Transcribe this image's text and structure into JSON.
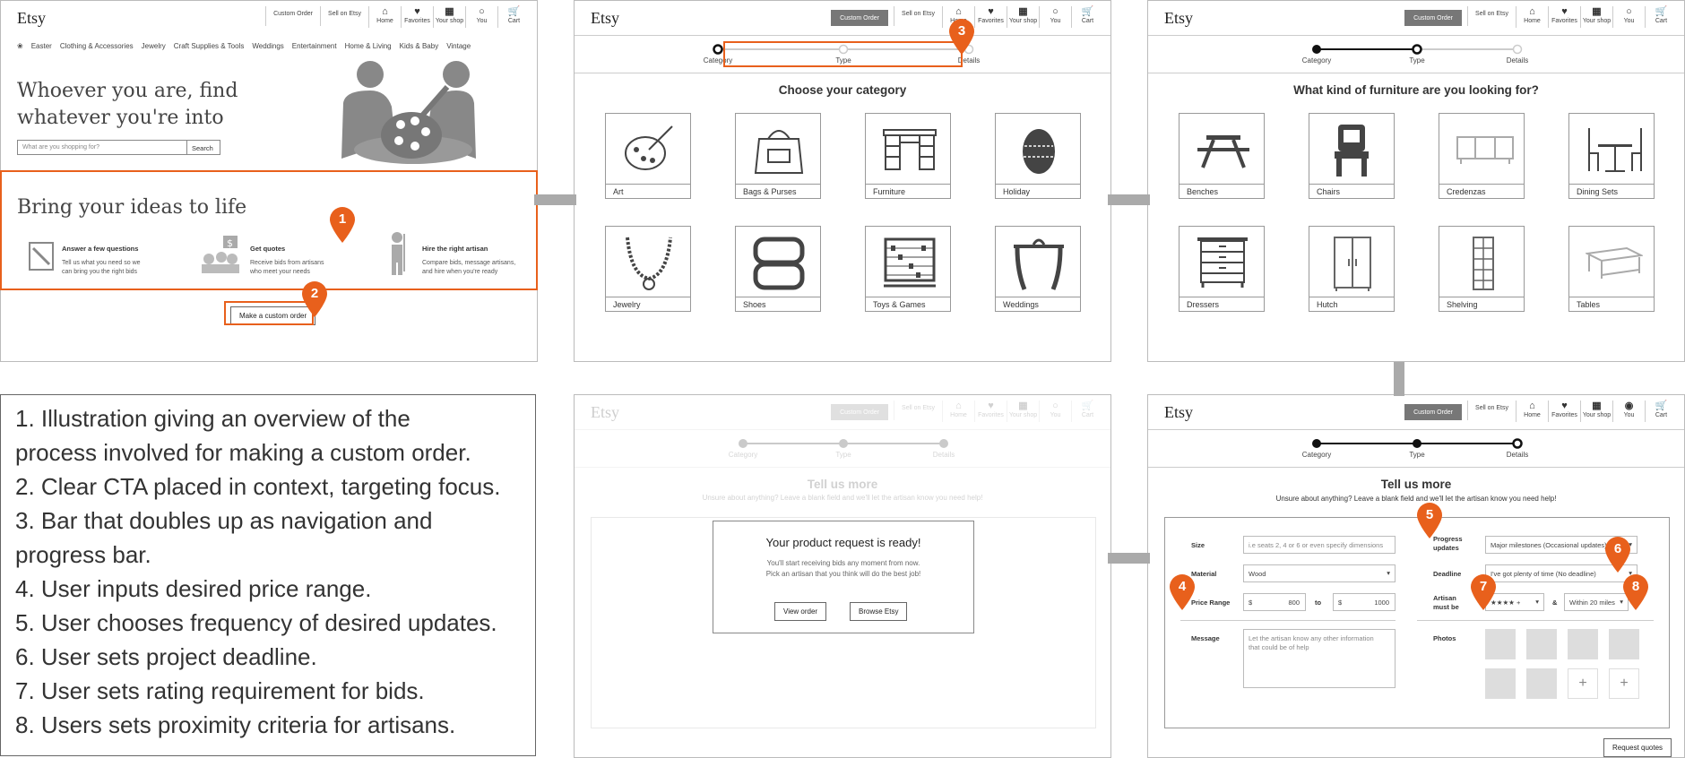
{
  "nav": {
    "logo": "Etsy",
    "custom_order": "Custom Order",
    "sell": "Sell on Etsy",
    "home": "Home",
    "favorites": "Favorites",
    "your_shop": "Your shop",
    "you": "You",
    "cart": "Cart"
  },
  "home_screen": {
    "categories": [
      "Easter",
      "Clothing & Accessories",
      "Jewelry",
      "Craft Supplies & Tools",
      "Weddings",
      "Entertainment",
      "Home & Living",
      "Kids & Baby",
      "Vintage"
    ],
    "hero_line1": "Whoever you are, find",
    "hero_line2": "whatever you're into",
    "search_placeholder": "What are you shopping for?",
    "search_button": "Search",
    "ideas_title": "Bring your ideas to life",
    "steps": [
      {
        "title": "Answer a few questions",
        "desc1": "Tell us what you need so we",
        "desc2": "can bring you the right bids"
      },
      {
        "title": "Get quotes",
        "desc1": "Receive bids from artisans",
        "desc2": "who meet your needs"
      },
      {
        "title": "Hire the right artisan",
        "desc1": "Compare bids, message artisans,",
        "desc2": "and hire when you're ready"
      }
    ],
    "cta": "Make a custom order"
  },
  "progress": {
    "category": "Category",
    "type": "Type",
    "details": "Details"
  },
  "category_screen": {
    "title": "Choose your category",
    "tiles": [
      "Art",
      "Bags & Purses",
      "Furniture",
      "Holiday",
      "Jewelry",
      "Shoes",
      "Toys & Games",
      "Weddings"
    ]
  },
  "type_screen": {
    "title": "What kind of furniture are you looking for?",
    "tiles": [
      "Benches",
      "Chairs",
      "Credenzas",
      "Dining Sets",
      "Dressers",
      "Hutch",
      "Shelving",
      "Tables"
    ]
  },
  "details_screen": {
    "title": "Tell us more",
    "subtitle": "Unsure about anything? Leave a blank field and we'll let the artisan know you need help!",
    "size_label": "Size",
    "size_placeholder": "i.e seats 2, 4 or 6 or even specify dimensions",
    "material_label": "Material",
    "material_value": "Wood",
    "price_label": "Price Range",
    "currency": "$",
    "price_min": "800",
    "to": "to",
    "price_max": "1000",
    "message_label": "Message",
    "message_placeholder1": "Let the artisan know any other information",
    "message_placeholder2": "that could be of help",
    "progress_label1": "Progress",
    "progress_label2": "updates",
    "progress_value": "Major milestones (Occasional updates)",
    "deadline_label": "Deadline",
    "deadline_value": "I've got plenty of time (No deadline)",
    "artisan_label1": "Artisan",
    "artisan_label2": "must be",
    "rating_value": "★★★★ +",
    "amp": "&",
    "distance_value": "Within 20 miles",
    "photos_label": "Photos",
    "request_button": "Request quotes"
  },
  "modal": {
    "title": "Your product request is ready!",
    "line1": "You'll start receiving bids any moment from now.",
    "line2": "Pick an artisan that you think will do the best job!",
    "view_order": "View order",
    "browse": "Browse Etsy"
  },
  "notes": [
    "1. Illustration giving an overview of the",
    "process involved for making a custom order.",
    "2. Clear CTA placed in context, targeting focus.",
    "3. Bar that doubles up as navigation and",
    "progress bar.",
    "4. User inputs desired price range.",
    "5. User chooses frequency of desired updates.",
    "6. User sets project deadline.",
    "7. User sets rating requirement for bids.",
    "8. Users sets proximity criteria for artisans."
  ],
  "markers": [
    "1",
    "2",
    "3",
    "4",
    "5",
    "6",
    "7",
    "8"
  ],
  "colors": {
    "accent": "#e8601c",
    "dark_button": "#777777"
  }
}
